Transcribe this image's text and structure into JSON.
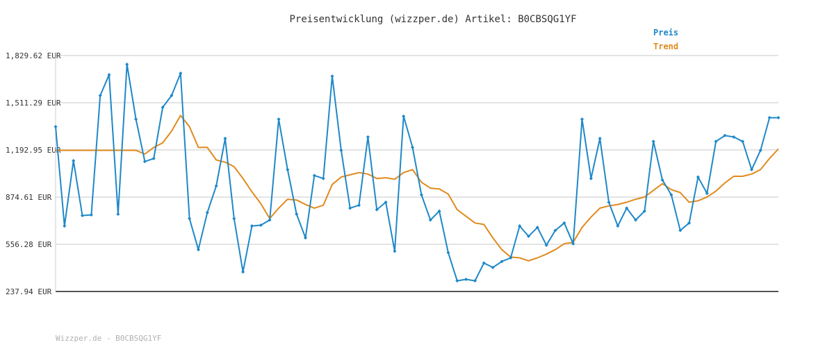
{
  "chart_data": {
    "type": "line",
    "title": "Preisentwicklung (wizzper.de) Artikel: B0CBSQG1YF",
    "footer": "Wizzper.de - B0CBSQG1YF",
    "ylim": [
      237.94,
      1829.62
    ],
    "yticks": [
      "237.94 EUR",
      "556.28 EUR",
      "874.61 EUR",
      "1,192.95 EUR",
      "1,511.29 EUR",
      "1,829.62 EUR"
    ],
    "grid": true,
    "legend_position": "top-right",
    "colors": {
      "preis": "#1e88c8",
      "trend": "#e08a1e",
      "grid": "#e4e4e4",
      "axis": "#555555"
    },
    "series": [
      {
        "name": "Preis",
        "values": [
          1350,
          680,
          1120,
          750,
          755,
          1560,
          1700,
          760,
          1770,
          1400,
          1115,
          1135,
          1480,
          1560,
          1710,
          730,
          520,
          770,
          950,
          1270,
          730,
          370,
          680,
          685,
          720,
          1400,
          1060,
          760,
          600,
          1020,
          1000,
          1690,
          1190,
          800,
          820,
          1280,
          790,
          840,
          510,
          1420,
          1210,
          890,
          720,
          780,
          500,
          310,
          320,
          310,
          430,
          400,
          440,
          465,
          680,
          610,
          670,
          550,
          650,
          700,
          560,
          1400,
          1000,
          1270,
          840,
          680,
          800,
          720,
          780,
          1250,
          990,
          890,
          650,
          700,
          1010,
          900,
          1250,
          1290,
          1280,
          1250,
          1060,
          1190,
          1410,
          1410
        ]
      },
      {
        "name": "Trend",
        "values": [
          1190,
          1190,
          1190,
          1190,
          1190,
          1190,
          1190,
          1190,
          1190,
          1190,
          1165,
          1210,
          1240,
          1320,
          1425,
          1350,
          1210,
          1210,
          1125,
          1110,
          1080,
          1000,
          910,
          830,
          730,
          800,
          860,
          855,
          825,
          800,
          820,
          960,
          1010,
          1025,
          1040,
          1030,
          1000,
          1005,
          995,
          1040,
          1060,
          975,
          935,
          930,
          895,
          790,
          745,
          700,
          690,
          600,
          520,
          470,
          465,
          445,
          465,
          490,
          520,
          560,
          570,
          670,
          740,
          800,
          815,
          825,
          840,
          860,
          875,
          920,
          965,
          925,
          905,
          840,
          850,
          875,
          915,
          970,
          1015,
          1015,
          1030,
          1060,
          1135,
          1200
        ]
      }
    ]
  }
}
